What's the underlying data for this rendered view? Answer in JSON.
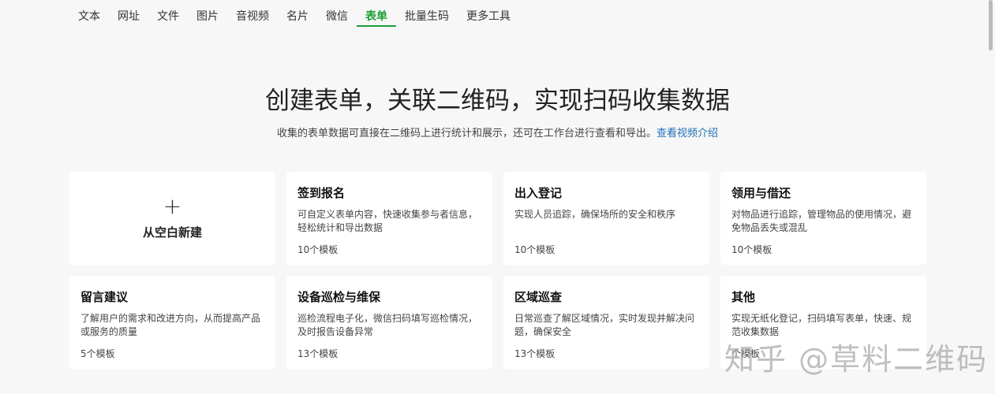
{
  "nav": {
    "tabs": [
      "文本",
      "网址",
      "文件",
      "图片",
      "音视频",
      "名片",
      "微信",
      "表单",
      "批量生码",
      "更多工具"
    ],
    "active": 7
  },
  "hero": {
    "title": "创建表单，关联二维码，实现扫码收集数据",
    "subtitle": "收集的表单数据可直接在二维码上进行统计和展示，还可在工作台进行查看和导出。",
    "link": "查看视频介绍"
  },
  "blank": {
    "plus": "+",
    "label": "从空白新建"
  },
  "cards": [
    {
      "title": "签到报名",
      "desc": "可自定义表单内容，快速收集参与者信息，轻松统计和导出数据",
      "count": "10个模板"
    },
    {
      "title": "出入登记",
      "desc": "实现人员追踪，确保场所的安全和秩序",
      "count": "10个模板"
    },
    {
      "title": "领用与借还",
      "desc": "对物品进行追踪，管理物品的使用情况，避免物品丢失或混乱",
      "count": "10个模板"
    },
    {
      "title": "留言建议",
      "desc": "了解用户的需求和改进方向，从而提高产品或服务的质量",
      "count": "5个模板"
    },
    {
      "title": "设备巡检与维保",
      "desc": "巡检流程电子化，微信扫码填写巡检情况，及时报告设备异常",
      "count": "13个模板"
    },
    {
      "title": "区域巡查",
      "desc": "日常巡查了解区域情况，实时发现并解决问题，确保安全",
      "count": "13个模板"
    },
    {
      "title": "其他",
      "desc": "实现无纸化登记，扫码填写表单，快速、规范收集数据",
      "count": "个模板"
    }
  ],
  "watermark": "知乎 @草料二维码"
}
